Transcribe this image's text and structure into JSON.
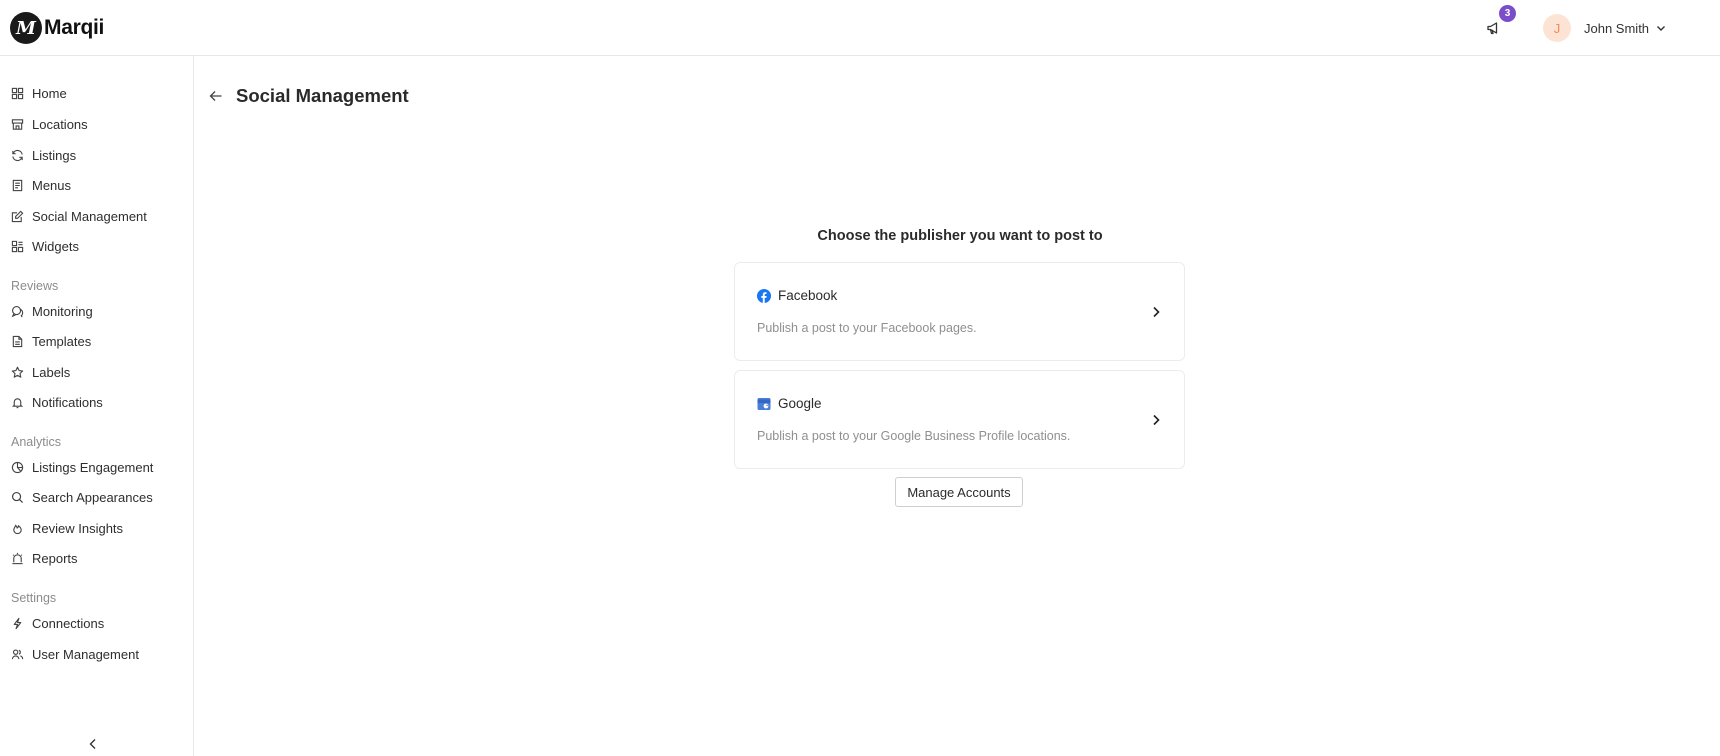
{
  "app": {
    "brand": "Marqii",
    "logo_glyph": "M"
  },
  "header": {
    "notifications_icon": "megaphone-icon",
    "notification_count": "3",
    "user_initial": "J",
    "user_name": "John Smith"
  },
  "sidebar": {
    "main_items": [
      {
        "label": "Home",
        "icon": "grid-icon"
      },
      {
        "label": "Locations",
        "icon": "store-icon"
      },
      {
        "label": "Listings",
        "icon": "refresh-icon"
      },
      {
        "label": "Menus",
        "icon": "menu-book-icon"
      },
      {
        "label": "Social Management",
        "icon": "edit-icon"
      },
      {
        "label": "Widgets",
        "icon": "widgets-icon"
      }
    ],
    "reviews_section": "Reviews",
    "reviews_items": [
      {
        "label": "Monitoring",
        "icon": "chat-bubbles-icon"
      },
      {
        "label": "Templates",
        "icon": "document-icon"
      },
      {
        "label": "Labels",
        "icon": "star-icon"
      },
      {
        "label": "Notifications",
        "icon": "bell-icon"
      }
    ],
    "analytics_section": "Analytics",
    "analytics_items": [
      {
        "label": "Listings Engagement",
        "icon": "pie-chart-icon"
      },
      {
        "label": "Search Appearances",
        "icon": "search-icon"
      },
      {
        "label": "Review Insights",
        "icon": "flame-icon"
      },
      {
        "label": "Reports",
        "icon": "alarm-icon"
      }
    ],
    "settings_section": "Settings",
    "settings_items": [
      {
        "label": "Connections",
        "icon": "lightning-icon"
      },
      {
        "label": "User Management",
        "icon": "users-icon"
      }
    ]
  },
  "main": {
    "title": "Social Management",
    "prompt": "Choose the publisher you want to post to",
    "publishers": [
      {
        "name": "Facebook",
        "description": "Publish a post to your Facebook pages.",
        "icon": "facebook-icon",
        "color": "#1877f2"
      },
      {
        "name": "Google",
        "description": "Publish a post to your Google Business Profile locations.",
        "icon": "google-business-icon",
        "color": "#4a7fd8"
      }
    ],
    "manage_button": "Manage Accounts"
  },
  "colors": {
    "badge": "#7a4ec9",
    "avatar_bg": "#fde3d3",
    "avatar_fg": "#f08a5a",
    "border": "#e8e8e8"
  }
}
